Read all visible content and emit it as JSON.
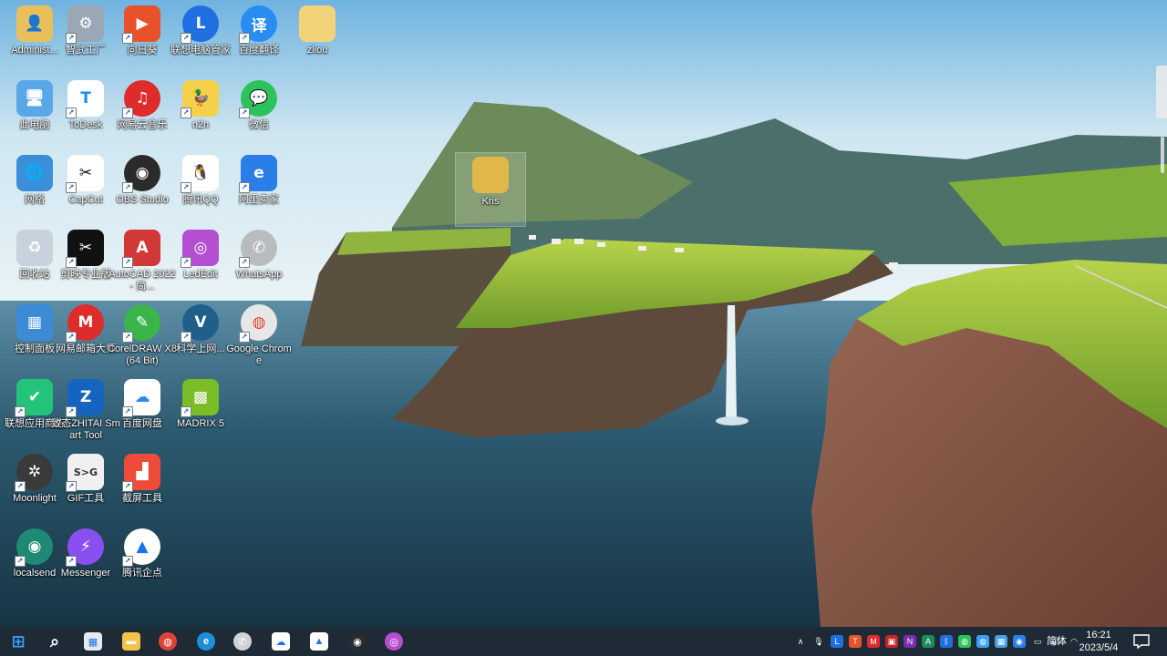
{
  "desktop": {
    "icons": [
      {
        "name": "administrator-folder",
        "label": "Administ...",
        "glyph": "👤",
        "bg": "#e8c05a",
        "shortcut": false
      },
      {
        "name": "yijian-gongchang",
        "label": "智武工厂",
        "glyph": "⚙",
        "bg": "#9aa8b6",
        "shortcut": true
      },
      {
        "name": "xiangrikui",
        "label": "向日葵",
        "glyph": "▶",
        "bg": "#e8522b",
        "shortcut": true
      },
      {
        "name": "lenovo-manager",
        "label": "联想电脑管家",
        "glyph": "L",
        "bg": "#1f6fe0",
        "shortcut": true
      },
      {
        "name": "baidu-translate",
        "label": "百度翻译",
        "glyph": "译",
        "bg": "#2a8cf0",
        "shortcut": true
      },
      {
        "name": "zliou-folder",
        "label": "zliou",
        "glyph": "",
        "bg": "#f2d37a",
        "shortcut": false
      },
      {
        "name": "this-pc",
        "label": "此电脑",
        "glyph": "🖥",
        "bg": "#5aa7e8",
        "shortcut": false
      },
      {
        "name": "todesk",
        "label": "ToDesk",
        "glyph": "T",
        "bg": "#ffffff",
        "fg": "#1a8cff",
        "shortcut": true
      },
      {
        "name": "netease-music",
        "label": "网易云音乐",
        "glyph": "♫",
        "bg": "#e02b2b",
        "shortcut": true
      },
      {
        "name": "n2n",
        "label": "n2n",
        "glyph": "🦆",
        "bg": "#f5d04a",
        "shortcut": true
      },
      {
        "name": "wechat",
        "label": "微信",
        "glyph": "💬",
        "bg": "#2dc35c",
        "shortcut": true
      },
      {
        "name": "network",
        "label": "网络",
        "glyph": "🌐",
        "bg": "#3b8fd8",
        "shortcut": false
      },
      {
        "name": "capcut",
        "label": "CapCut",
        "glyph": "✂",
        "bg": "#ffffff",
        "fg": "#111",
        "shortcut": true
      },
      {
        "name": "obs-studio",
        "label": "OBS Studio",
        "glyph": "◉",
        "bg": "#2b2b2b",
        "shortcut": true
      },
      {
        "name": "tencent-qq",
        "label": "腾讯QQ",
        "glyph": "🐧",
        "bg": "#ffffff",
        "fg": "#111",
        "shortcut": true
      },
      {
        "name": "aliwangwang",
        "label": "阿里卖家",
        "glyph": "e",
        "bg": "#2a7ee8",
        "shortcut": true
      },
      {
        "name": "recycle-bin",
        "label": "回收站",
        "glyph": "♻",
        "bg": "#c7d2dc",
        "shortcut": false
      },
      {
        "name": "jianying-pro",
        "label": "剪映专业版",
        "glyph": "✂",
        "bg": "#111111",
        "shortcut": true
      },
      {
        "name": "autocad-2022",
        "label": "AutoCAD 2022 - 简...",
        "glyph": "A",
        "bg": "#d33838",
        "shortcut": true
      },
      {
        "name": "ledit",
        "label": "LedEdit",
        "glyph": "◎",
        "bg": "#b44fd1",
        "shortcut": true
      },
      {
        "name": "whatsapp",
        "label": "WhatsApp",
        "glyph": "✆",
        "bg": "#b9bcbf",
        "shortcut": true
      },
      {
        "name": "control-panel",
        "label": "控制面板",
        "glyph": "▦",
        "bg": "#3d8ad6",
        "shortcut": false
      },
      {
        "name": "netease-master",
        "label": "网易邮箱大师",
        "glyph": "M",
        "bg": "#e02b2b",
        "shortcut": true
      },
      {
        "name": "coreldraw-x8",
        "label": "CorelDRAW X8 (64 Bit)",
        "glyph": "✎",
        "bg": "#3bb54a",
        "shortcut": true
      },
      {
        "name": "kexue-shangwang",
        "label": "科学上网...",
        "glyph": "V",
        "bg": "#1f5f8a",
        "shortcut": true
      },
      {
        "name": "google-chrome",
        "label": "Google Chrome",
        "glyph": "◍",
        "bg": "#e7e7e7",
        "fg": "#db4437",
        "shortcut": true
      },
      {
        "name": "lenovo-appstore",
        "label": "联想应用商店",
        "glyph": "✔",
        "bg": "#22c47a",
        "shortcut": true
      },
      {
        "name": "zhitai-smart-tool",
        "label": "致态ZHITAI Smart Tool",
        "glyph": "Z",
        "bg": "#1565c0",
        "shortcut": true
      },
      {
        "name": "baidu-netdisk",
        "label": "百度网盘",
        "glyph": "☁",
        "bg": "#ffffff",
        "fg": "#2a8cf0",
        "shortcut": true
      },
      {
        "name": "madrix-5",
        "label": "MADRIX 5",
        "glyph": "▩",
        "bg": "#7bbd27",
        "shortcut": true
      },
      {
        "name": "moonlight",
        "label": "Moonlight",
        "glyph": "✲",
        "bg": "#3a3a3a",
        "shortcut": true
      },
      {
        "name": "gif-tool",
        "label": "GIF工具",
        "glyph": "S>G",
        "bg": "#f0f0f0",
        "fg": "#333",
        "shortcut": true
      },
      {
        "name": "screenshot-tool",
        "label": "截屏工具",
        "glyph": "▟",
        "bg": "#ef4b3b",
        "shortcut": true
      },
      {
        "name": "localsend",
        "label": "localsend",
        "glyph": "◉",
        "bg": "#1e8a74",
        "shortcut": true
      },
      {
        "name": "messenger",
        "label": "Messenger",
        "glyph": "⚡",
        "bg": "#8a4ff0",
        "shortcut": true
      },
      {
        "name": "tencent-qidian",
        "label": "腾讯企点",
        "glyph": "▲",
        "bg": "#ffffff",
        "fg": "#1a73e8",
        "shortcut": true
      },
      {
        "name": "kris-folder",
        "label": "Kris",
        "glyph": "",
        "bg": "#e0b84a",
        "shortcut": false
      }
    ]
  },
  "taskbar": {
    "apps": [
      {
        "name": "start",
        "glyph": "⊞",
        "bg": "transparent"
      },
      {
        "name": "search",
        "glyph": "⌕",
        "bg": "transparent"
      },
      {
        "name": "microsoft-store",
        "glyph": "▦",
        "bg": "#e9e9e9"
      },
      {
        "name": "file-explorer",
        "glyph": "▬",
        "bg": "#f2c24b"
      },
      {
        "name": "chrome",
        "glyph": "◍",
        "bg": "#db4437"
      },
      {
        "name": "edge",
        "glyph": "e",
        "bg": "#1d8fd6"
      },
      {
        "name": "whatsapp",
        "glyph": "✆",
        "bg": "#cfd3d6"
      },
      {
        "name": "baidu-netdisk",
        "glyph": "☁",
        "bg": "#ffffff"
      },
      {
        "name": "tencent-qidian",
        "glyph": "▲",
        "bg": "#ffffff"
      },
      {
        "name": "obs",
        "glyph": "◉",
        "bg": "#2b2b2b"
      },
      {
        "name": "ledit",
        "glyph": "◎",
        "bg": "#b44fd1"
      }
    ],
    "tray": [
      {
        "name": "show-hidden",
        "glyph": "∧",
        "bg": "transparent"
      },
      {
        "name": "microphone",
        "glyph": "🎙",
        "bg": "transparent"
      },
      {
        "name": "lenovo",
        "glyph": "L",
        "bg": "#1f6fe0"
      },
      {
        "name": "todesk",
        "glyph": "T",
        "bg": "#e8522b"
      },
      {
        "name": "netease-mail",
        "glyph": "M",
        "bg": "#e02b2b"
      },
      {
        "name": "app-red",
        "glyph": "▣",
        "bg": "#c62828"
      },
      {
        "name": "onenote",
        "glyph": "N",
        "bg": "#7b2fb0"
      },
      {
        "name": "autocad",
        "glyph": "A",
        "bg": "#1f8a5a"
      },
      {
        "name": "bluetooth",
        "glyph": "ᛒ",
        "bg": "#1f6fe0"
      },
      {
        "name": "wechat",
        "glyph": "◍",
        "bg": "#2dc35c"
      },
      {
        "name": "wechat-work",
        "glyph": "◍",
        "bg": "#3aa0ff"
      },
      {
        "name": "network-app",
        "glyph": "▦",
        "bg": "#4aa0e8"
      },
      {
        "name": "app-blue",
        "glyph": "◉",
        "bg": "#2a7ee8"
      },
      {
        "name": "battery",
        "glyph": "▭",
        "bg": "transparent"
      },
      {
        "name": "volume",
        "glyph": "🔊",
        "bg": "transparent"
      },
      {
        "name": "wifi",
        "glyph": "◠",
        "bg": "transparent"
      }
    ],
    "language": "简体",
    "time": "16:21",
    "date": "2023/5/4"
  }
}
